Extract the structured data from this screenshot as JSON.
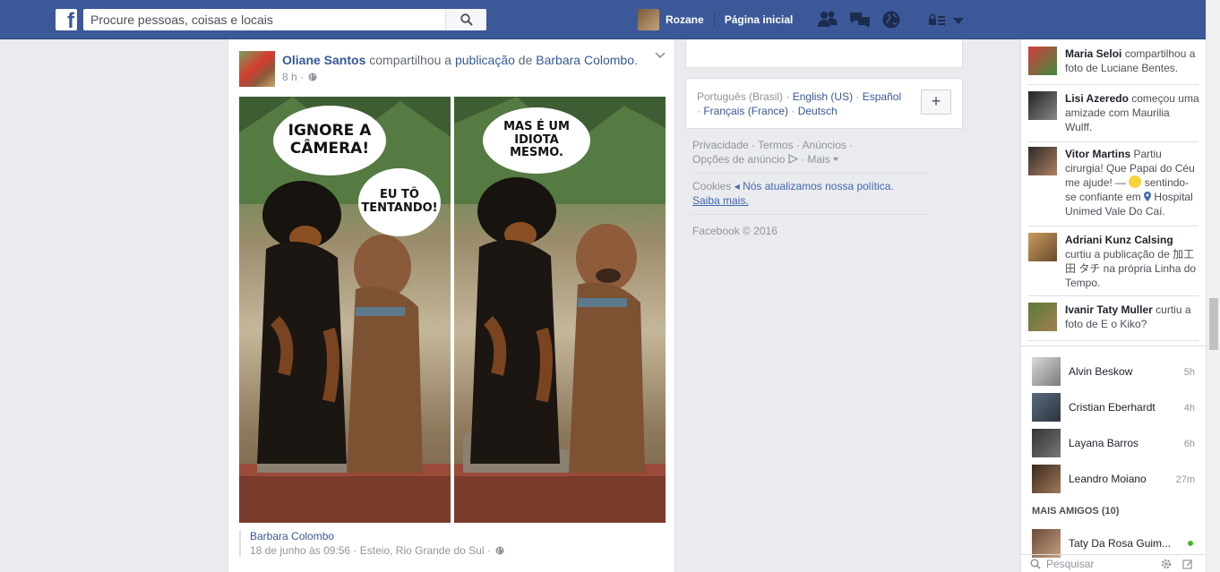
{
  "topbar": {
    "logo": "f",
    "search_placeholder": "Procure pessoas, coisas e locais",
    "profile_name": "Rozane",
    "home_label": "Página inicial"
  },
  "post": {
    "author": "Oliane Santos",
    "shared_text": "compartilhou a",
    "shared_link": "publicação",
    "of_text": "de",
    "original_author": "Barbara Colombo",
    "period": ".",
    "time": "8 h ·",
    "image": {
      "left_bubble_1": "IGNORE A CÂMERA!",
      "left_bubble_2": "EU TÔ TENTANDO!",
      "right_bubble": "MAS É UM IDIOTA MESMO."
    },
    "share": {
      "name": "Barbara Colombo",
      "meta": "18 de junho às 09:56 · Esteio, Rio Grande do Sul ·"
    }
  },
  "languages": {
    "current": "Português (Brasil)",
    "sep": " · ",
    "items": [
      "English (US)",
      "Español",
      "Français (France)",
      "Deutsch"
    ],
    "add_label": "+"
  },
  "footer": {
    "links": [
      "Privacidade",
      "Termos",
      "Anúncios",
      "Opções de anúncio",
      "Mais"
    ],
    "cookies": "Cookies",
    "policy": "Nós atualizamos nossa política.",
    "learn_more": "Saiba mais.",
    "copyright": "Facebook © 2016"
  },
  "ticker": [
    {
      "name": "Maria Seloi",
      "text": "compartilhou a foto de Luciane Bentes."
    },
    {
      "name": "Lisi Azeredo",
      "text": "começou uma amizade com Maurilia Wulff."
    },
    {
      "name": "Vitor Martins",
      "text": "Partiu cirurgia! Que Papai do Céu me ajude! —",
      "text2": "sentindo-se confiante em",
      "place": "Hospital Unimed Vale Do Caí."
    },
    {
      "name": "Adriani Kunz Calsing",
      "text": "curtiu a publicação de 加工田 タチ na própria Linha do Tempo."
    },
    {
      "name": "Ivanir Taty Muller",
      "text": "curtiu a foto de E o Kiko?"
    }
  ],
  "chat": [
    {
      "name": "Alvin Beskow",
      "time": "5h"
    },
    {
      "name": "Cristian Eberhardt",
      "time": "4h"
    },
    {
      "name": "Layana Barros",
      "time": "6h"
    },
    {
      "name": "Leandro Moiano",
      "time": "27m"
    }
  ],
  "more_friends": "MAIS AMIGOS (10)",
  "online": [
    {
      "name": "Taty Da Rosa Guim..."
    }
  ],
  "chat_search_placeholder": "Pesquisar"
}
